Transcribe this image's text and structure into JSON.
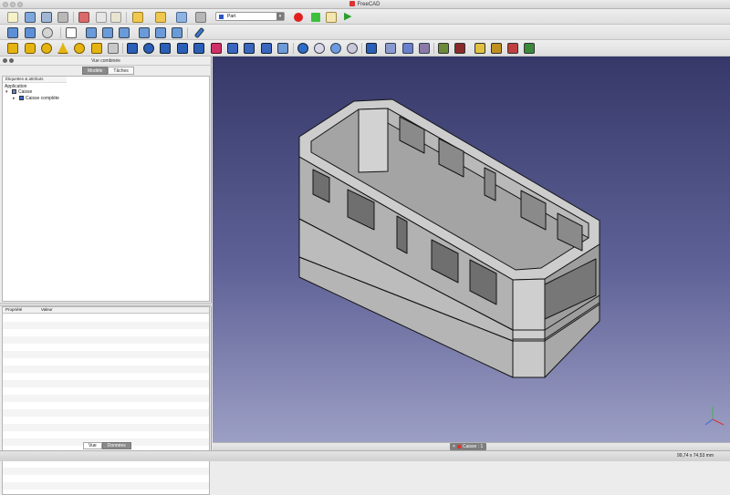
{
  "window": {
    "title": "FreeCAD"
  },
  "toolbar": {
    "workbench": "Part"
  },
  "combo_view": {
    "title": "Vue combinée",
    "tabs": [
      "Modèle",
      "Tâches"
    ],
    "active_tab": "Modèle",
    "tree_header": "Étiquettes & attributs",
    "tree": {
      "root": "Application",
      "items": [
        {
          "label": "Caisse",
          "level": 1
        },
        {
          "label": "Caisse complète",
          "level": 2
        }
      ]
    },
    "properties": {
      "col_property": "Propriété",
      "col_value": "Valeur"
    },
    "bottom_tabs": [
      "Vue",
      "Données"
    ],
    "active_bottom_tab": "Données"
  },
  "document_tab": {
    "label": "Caisse : 1"
  },
  "status": {
    "dimensions": "99,74 x 74,53 mm"
  },
  "colors": {
    "viewport_top": "#353868",
    "viewport_bottom": "#9c9fc4",
    "model_face": "#c0c0c0",
    "model_edge": "#141414"
  }
}
